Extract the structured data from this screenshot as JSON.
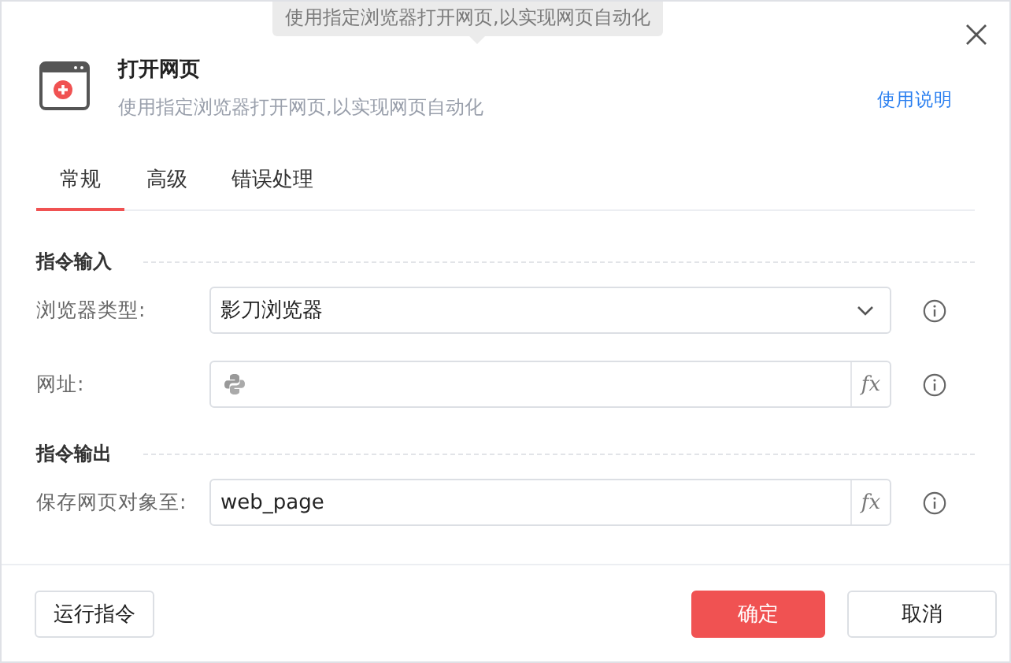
{
  "tooltip": {
    "text": "使用指定浏览器打开网页,以实现网页自动化"
  },
  "header": {
    "title": "打开网页",
    "description": "使用指定浏览器打开网页,以实现网页自动化",
    "help_link": "使用说明"
  },
  "tabs": [
    {
      "label": "常规",
      "selected": true
    },
    {
      "label": "高级",
      "selected": false
    },
    {
      "label": "错误处理",
      "selected": false
    }
  ],
  "sections": [
    {
      "title": "指令输入",
      "fields": [
        {
          "kind": "select",
          "label": "浏览器类型:",
          "value": "影刀浏览器"
        },
        {
          "kind": "expression",
          "label": "网址:",
          "python": true,
          "function_button": "fx"
        }
      ]
    },
    {
      "title": "指令输出",
      "fields": [
        {
          "kind": "expression",
          "label": "保存网页对象至:",
          "value": "web_page",
          "python": false,
          "function_button": "fx"
        }
      ]
    }
  ],
  "footer": {
    "run_button": "运行指令",
    "ok_button": "确定",
    "cancel_button": "取消"
  }
}
